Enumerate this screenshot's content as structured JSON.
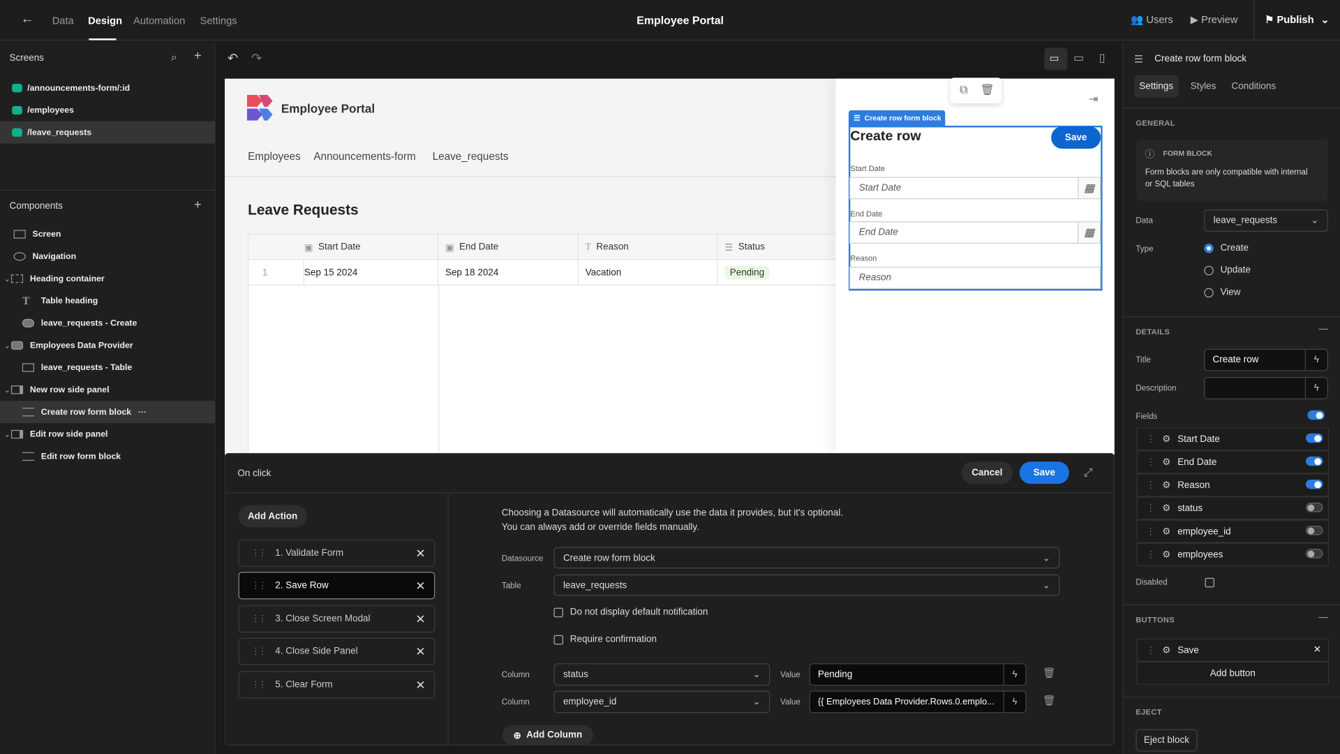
{
  "topbar": {
    "tabs": [
      "Data",
      "Design",
      "Automation",
      "Settings"
    ],
    "active_tab": "Design",
    "title": "Employee Portal",
    "users": "Users",
    "preview": "Preview",
    "publish": "Publish"
  },
  "screens": {
    "title": "Screens",
    "items": [
      "/announcements-form/:id",
      "/employees",
      "/leave_requests"
    ],
    "selected": "/leave_requests"
  },
  "components": {
    "title": "Components",
    "items": [
      {
        "label": "Screen",
        "icon": "screen-icon"
      },
      {
        "label": "Navigation",
        "icon": "eye-icon"
      },
      {
        "label": "Heading container",
        "icon": "container-icon"
      },
      {
        "label": "Table heading",
        "icon": "text-icon"
      },
      {
        "label": "leave_requests - Create",
        "icon": "button-icon"
      },
      {
        "label": "Employees Data Provider",
        "icon": "database-icon"
      },
      {
        "label": "leave_requests - Table",
        "icon": "table-icon"
      },
      {
        "label": "New row side panel",
        "icon": "side-panel-icon"
      },
      {
        "label": "Create row form block",
        "icon": "form-icon"
      },
      {
        "label": "Edit row side panel",
        "icon": "side-panel-icon"
      },
      {
        "label": "Edit row form block",
        "icon": "form-icon"
      }
    ],
    "selected": "Create row form block"
  },
  "preview": {
    "app_name": "Employee Portal",
    "nav": [
      "Employees",
      "Announcements-form",
      "Leave_requests"
    ],
    "heading": "Leave Requests",
    "table": {
      "columns": [
        "Start Date",
        "End Date",
        "Reason",
        "Status"
      ],
      "rows": [
        {
          "index": "1",
          "start": "Sep 15 2024",
          "end": "Sep 18 2024",
          "reason": "Vacation",
          "status": "Pending"
        }
      ]
    },
    "form": {
      "tag": "Create row form block",
      "title": "Create row",
      "save": "Save",
      "fields": [
        {
          "label": "Start Date",
          "placeholder": "Start Date"
        },
        {
          "label": "End Date",
          "placeholder": "End Date"
        },
        {
          "label": "Reason",
          "placeholder": "Reason"
        }
      ]
    }
  },
  "onclick": {
    "title": "On click",
    "cancel": "Cancel",
    "save": "Save",
    "add_action": "Add Action",
    "actions": [
      "1. Validate Form",
      "2. Save Row",
      "3. Close Screen Modal",
      "4. Close Side Panel",
      "5. Clear Form"
    ],
    "selected_action": "2. Save Row",
    "info1": "Choosing a Datasource will automatically use the data it provides, but it's optional.",
    "info2": "You can always add or override fields manually.",
    "datasource_label": "Datasource",
    "datasource": "Create row form block",
    "table_label": "Table",
    "table": "leave_requests",
    "no_notification": "Do not display default notification",
    "require_confirmation": "Require confirmation",
    "column_label": "Column",
    "value_label": "Value",
    "columns": [
      {
        "column": "status",
        "value": "Pending"
      },
      {
        "column": "employee_id",
        "value": "{{ Employees Data Provider.Rows.0.emplo..."
      }
    ],
    "add_column": "Add Column"
  },
  "settings": {
    "header": "Create row form block",
    "tabs": [
      "Settings",
      "Styles",
      "Conditions"
    ],
    "active_tab": "Settings",
    "general": "GENERAL",
    "info_title": "FORM BLOCK",
    "info_text": "Form blocks are only compatible with internal or SQL tables",
    "data_label": "Data",
    "data_value": "leave_requests",
    "type_label": "Type",
    "types": [
      "Create",
      "Update",
      "View"
    ],
    "type_selected": "Create",
    "details": "DETAILS",
    "title_label": "Title",
    "title_value": "Create row",
    "description_label": "Description",
    "fields_label": "Fields",
    "fields_toggle": true,
    "fields": [
      {
        "name": "Start Date",
        "on": true
      },
      {
        "name": "End Date",
        "on": true
      },
      {
        "name": "Reason",
        "on": true
      },
      {
        "name": "status",
        "on": false
      },
      {
        "name": "employee_id",
        "on": false
      },
      {
        "name": "employees",
        "on": false
      }
    ],
    "disabled_label": "Disabled",
    "buttons": "BUTTONS",
    "button_items": [
      "Save"
    ],
    "add_button": "Add button",
    "eject": "EJECT",
    "eject_button": "Eject block"
  },
  "colors": {
    "accent": "#2d7de0",
    "screen_dot": "#12b08a",
    "pending_badge": "#eaf8e0"
  }
}
